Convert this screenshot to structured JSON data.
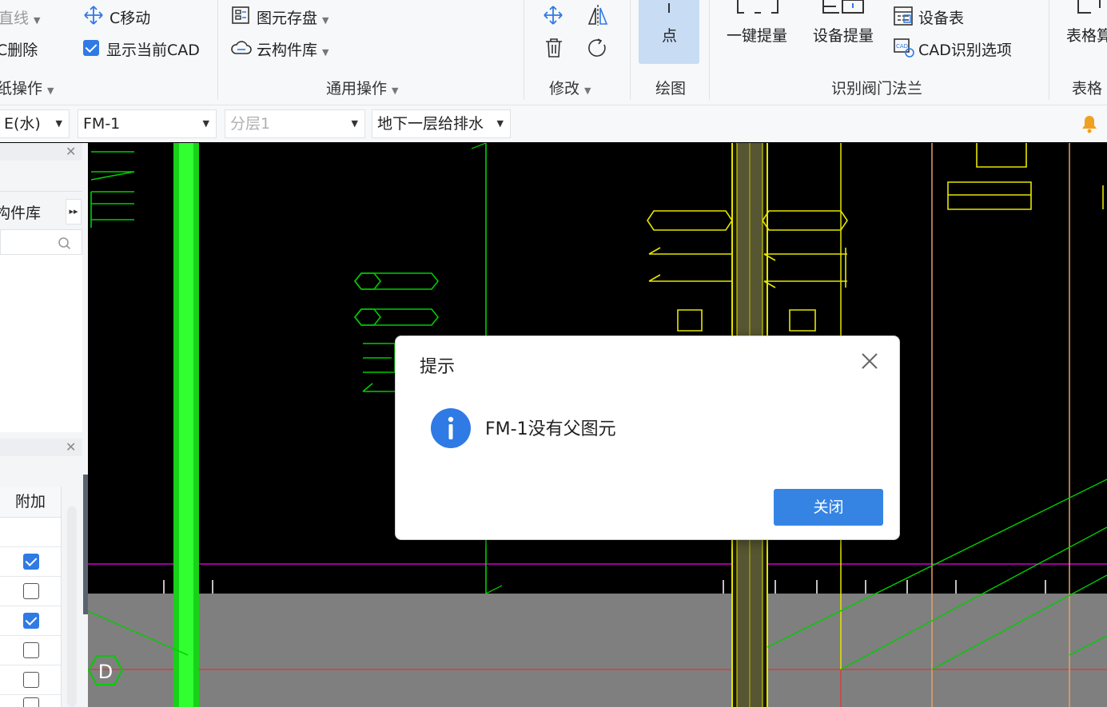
{
  "ribbon": {
    "drawing_ops": {
      "line_partial": "直线",
      "delete_partial": "C删除",
      "move": "C移动",
      "show_cad": "显示当前CAD",
      "group_label_partial": "纸操作"
    },
    "general_ops": {
      "save_elements": "图元存盘",
      "cloud_library": "云构件库",
      "group_label": "通用操作"
    },
    "modify": {
      "group_label": "修改"
    },
    "draw": {
      "point": "点",
      "group_label": "绘图"
    },
    "valve_recognition": {
      "one_key": "一键提量",
      "device_qty": "设备提量",
      "device_table": "设备表",
      "cad_options": "CAD识别选项",
      "group_label": "识别阀门法兰"
    },
    "table": {
      "label_partial": "表格算",
      "group_label_partial": "表格"
    }
  },
  "selectors": {
    "system_partial": "E(水)",
    "component": "FM-1",
    "layer": "分层1",
    "floor": "地下一层给排水"
  },
  "left_panel": {
    "library_partial": "构件库",
    "column_header": "附加",
    "checkboxes": [
      true,
      false,
      true,
      false,
      false
    ]
  },
  "canvas": {
    "axis_label": "D"
  },
  "dialog": {
    "title": "提示",
    "message": "FM-1没有父图元",
    "close_button": "关闭"
  },
  "colors": {
    "accent": "#3584e4",
    "cad_green": "#00ff00",
    "cad_yellow": "#e6e600",
    "cad_magenta": "#cc00cc",
    "cad_red": "#ff2020",
    "cad_orange": "#e8a060"
  }
}
